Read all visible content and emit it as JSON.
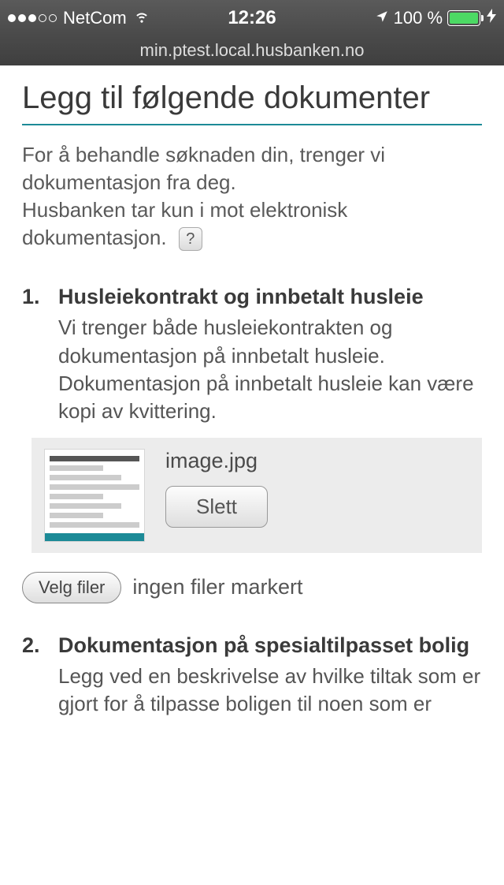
{
  "statusbar": {
    "carrier": "NetCom",
    "time": "12:26",
    "battery_pct": "100 %"
  },
  "url": "min.ptest.local.husbanken.no",
  "page": {
    "title": "Legg til følgende dokumenter",
    "intro_line1": "For å behandle søknaden din, trenger vi dokumentasjon fra deg.",
    "intro_line2": "Husbanken tar kun i mot elektronisk dokumentasjon.",
    "help_label": "?"
  },
  "docs": [
    {
      "num": "1.",
      "title": "Husleiekontrakt og innbetalt husleie",
      "desc": "Vi trenger både husleiekontrakten og dokumentasjon på innbetalt husleie. Dokumentasjon på innbetalt husleie kan være kopi av kvittering.",
      "file_name": "image.jpg",
      "delete_label": "Slett",
      "pick_label": "Velg filer",
      "pick_status": "ingen filer markert"
    },
    {
      "num": "2.",
      "title": "Dokumentasjon på spesialtilpasset bolig",
      "desc": "Legg ved en beskrivelse av hvilke tiltak som er gjort for å tilpasse boligen til noen som er"
    }
  ]
}
